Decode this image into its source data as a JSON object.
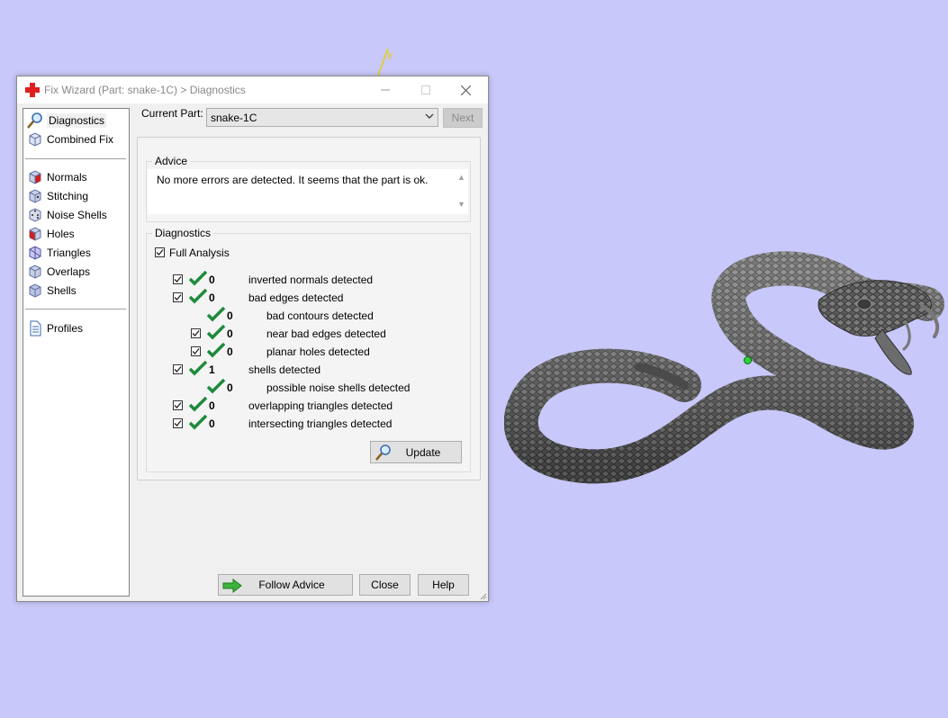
{
  "window": {
    "title": "Fix Wizard (Part: snake-1C) > Diagnostics"
  },
  "viewport": {
    "axis_label": "y"
  },
  "sidebar": {
    "items": [
      {
        "label": "Diagnostics",
        "icon": "magnifier-icon",
        "selected": true
      },
      {
        "label": "Combined Fix",
        "icon": "cube-icon"
      },
      {
        "label": "Normals",
        "icon": "cube-red-face-icon"
      },
      {
        "label": "Stitching",
        "icon": "cube-stitch-icon"
      },
      {
        "label": "Noise Shells",
        "icon": "dice-icon"
      },
      {
        "label": "Holes",
        "icon": "cube-hole-icon"
      },
      {
        "label": "Triangles",
        "icon": "triangle-cube-icon"
      },
      {
        "label": "Overlaps",
        "icon": "overlap-cube-icon"
      },
      {
        "label": "Shells",
        "icon": "shell-cube-icon"
      },
      {
        "label": "Profiles",
        "icon": "document-icon"
      }
    ]
  },
  "part": {
    "label": "Current Part:",
    "value": "snake-1C",
    "next_label": "Next"
  },
  "advice": {
    "title": "Advice",
    "text": "No more errors are detected. It seems that the part is ok."
  },
  "diagnostics": {
    "title": "Diagnostics",
    "full_analysis_label": "Full Analysis",
    "full_analysis_checked": true,
    "rows": [
      {
        "checkbox": true,
        "count": "0",
        "label": "inverted normals detected"
      },
      {
        "checkbox": true,
        "count": "0",
        "label": "bad edges detected"
      },
      {
        "checkbox": false,
        "count": "0",
        "label": "bad contours detected"
      },
      {
        "checkbox": true,
        "count": "0",
        "label": "near bad edges detected"
      },
      {
        "checkbox": true,
        "count": "0",
        "label": "planar holes detected"
      },
      {
        "checkbox": true,
        "count": "1",
        "label": "shells detected"
      },
      {
        "checkbox": false,
        "count": "0",
        "label": "possible noise shells detected"
      },
      {
        "checkbox": true,
        "count": "0",
        "label": "overlapping triangles detected"
      },
      {
        "checkbox": true,
        "count": "0",
        "label": "intersecting triangles detected"
      }
    ],
    "update_label": "Update"
  },
  "footer": {
    "follow_advice_label": "Follow Advice",
    "close_label": "Close",
    "help_label": "Help"
  },
  "colors": {
    "background": "#c8c8fa",
    "check_green": "#1e8a3c",
    "arrow_green": "#3cb43c"
  }
}
